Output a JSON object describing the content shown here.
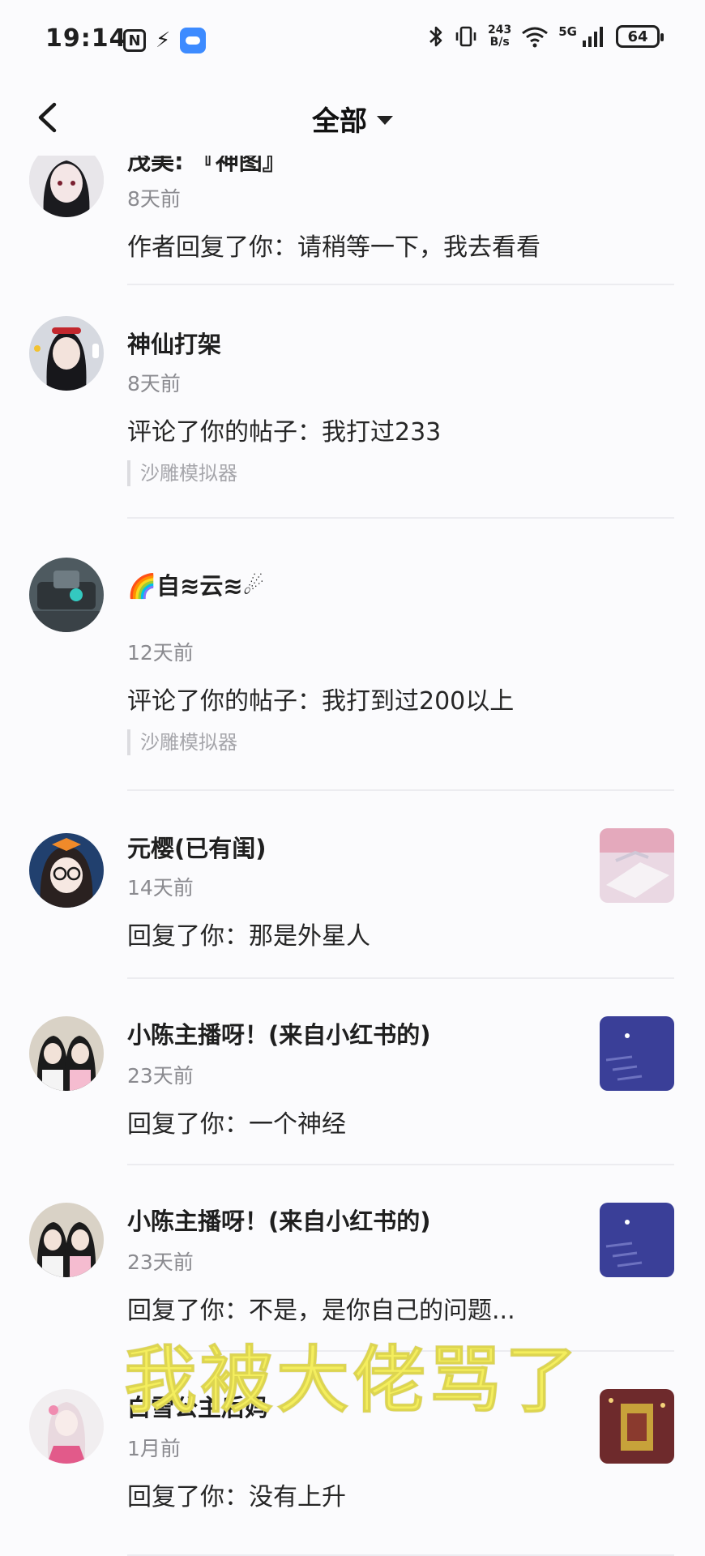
{
  "status_bar": {
    "time": "19:14",
    "nfc": "N",
    "net_speed_value": "243",
    "net_speed_unit": "B/s",
    "network": "5G",
    "battery": "64"
  },
  "nav": {
    "title": "全部"
  },
  "messages": [
    {
      "name": "茂美: 『神图』",
      "time": "8天前",
      "text": "作者回复了你：请稍等一下，我去看看",
      "tag": "",
      "avatar_color": "#d9d9de"
    },
    {
      "name": "神仙打架",
      "time": "8天前",
      "text": "评论了你的帖子：我打过233",
      "tag": "沙雕模拟器",
      "avatar_color": "#cfd3dc"
    },
    {
      "name": "🌈自≋云≋☄",
      "time": "12天前",
      "text": "评论了你的帖子：我打到过200以上",
      "tag": "沙雕模拟器",
      "avatar_color": "#5d6b72"
    },
    {
      "name": "元樱(已有闺)",
      "time": "14天前",
      "text": "回复了你：那是外星人",
      "tag": "",
      "avatar_color": "#2b4a78",
      "thumb_color": "#e9d3e0"
    },
    {
      "name": "小陈主播呀！(来自小红书的)",
      "time": "23天前",
      "text": "回复了你：一个神经",
      "tag": "",
      "avatar_color": "#d7cfc4",
      "thumb_color": "#3b3f9a"
    },
    {
      "name": "小陈主播呀！(来自小红书的)",
      "time": "23天前",
      "text": "回复了你：不是，是你自己的问题...",
      "tag": "",
      "avatar_color": "#d7cfc4",
      "thumb_color": "#3b3f9a"
    },
    {
      "name": "白雪公主后妈",
      "time": "1月前",
      "text": "回复了你：没有上升",
      "tag": "",
      "avatar_color": "#efe7ec",
      "thumb_color": "#7a2f2f"
    }
  ],
  "overlay_caption": "我被大佬骂了"
}
